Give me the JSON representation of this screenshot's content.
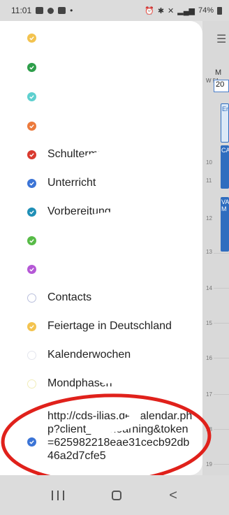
{
  "status_bar": {
    "time": "11:01",
    "battery": "74%",
    "left_icons": [
      "gallery-icon",
      "messages-icon",
      "photo-icon",
      "dot-icon"
    ],
    "right_icons": [
      "alarm-icon",
      "bluetooth-icon",
      "mute-icon",
      "lte-signal-icon",
      "battery-icon"
    ]
  },
  "calendar_background": {
    "menu_icon": "hamburger-icon",
    "day_label": "M",
    "week_label": "W 51",
    "date_label": "20",
    "event_labels": [
      "Er",
      "CA",
      "VA M"
    ],
    "hours": [
      "10",
      "11",
      "12",
      "13",
      "14",
      "15",
      "16",
      "17",
      "18",
      "19"
    ]
  },
  "calendars": [
    {
      "label": "",
      "color": "#f3c34f",
      "checked": true
    },
    {
      "label": "",
      "color": "#2e9e4a",
      "checked": true
    },
    {
      "label": "",
      "color": "#5ed0cf",
      "checked": true
    },
    {
      "label": "",
      "color": "#ec7a3c",
      "checked": true
    },
    {
      "label": "Schultermine",
      "color": "#d93a2f",
      "checked": true
    },
    {
      "label": "Unterricht",
      "color": "#3b74d6",
      "checked": true
    },
    {
      "label": "Vorbereitung",
      "color": "#1f8fb6",
      "checked": true
    },
    {
      "label": "",
      "color": "#57bb47",
      "checked": true
    },
    {
      "label": "",
      "color": "#b558d6",
      "checked": true
    },
    {
      "label": "Contacts",
      "color": "#b9bfdc",
      "checked": false
    },
    {
      "label": "Feiertage in Deutschland",
      "color": "#f3c34f",
      "checked": true
    },
    {
      "label": "Kalenderwochen",
      "color": "#d8dbe8",
      "checked": false
    },
    {
      "label": "Mondphasen",
      "color": "#f1edb9",
      "checked": false
    }
  ],
  "url_calendar": {
    "label": "http://cds-ilias.de/calendar.php?client_id=elearning&token=625982218eae31cecb92db46a2d7cfe5",
    "color": "#3b74d6",
    "checked": true
  },
  "navbar": {
    "recent_icon": "recent-apps-icon",
    "home_icon": "home-icon",
    "back_icon": "back-icon",
    "back_glyph": "<"
  },
  "colors": {
    "highlight_oval": "#e0211b",
    "event_blue": "#2f6dbf"
  }
}
